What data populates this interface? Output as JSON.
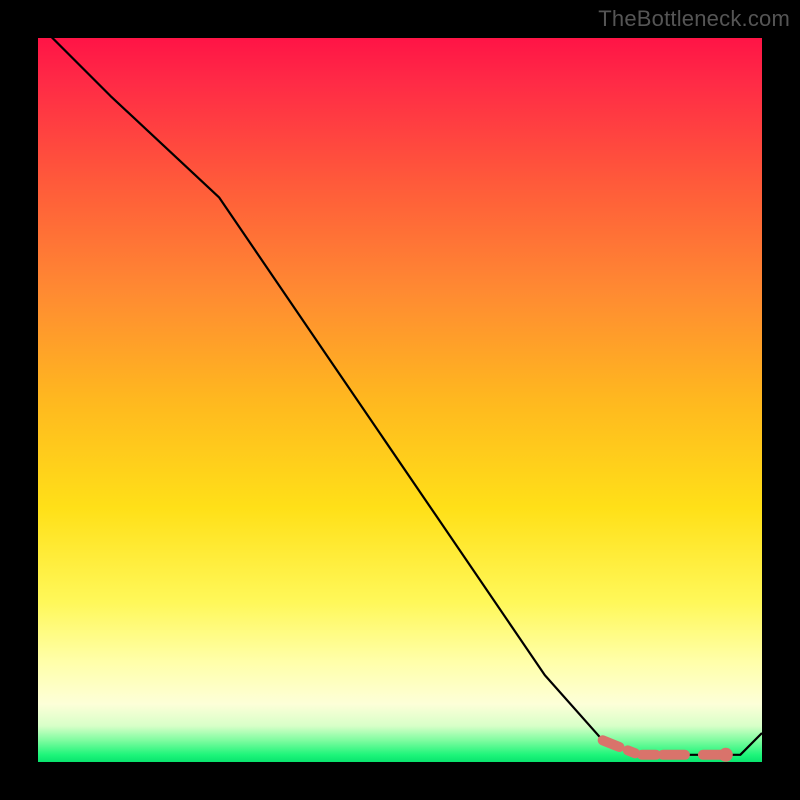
{
  "watermark": "TheBottleneck.com",
  "colors": {
    "gradient_top": "#ff1446",
    "gradient_bottom": "#08e46e",
    "line": "#000000",
    "tail_highlight": "#d9736b",
    "tail_dot": "#d9736b",
    "frame_bg": "#000000"
  },
  "chart_data": {
    "type": "line",
    "title": "",
    "xlabel": "",
    "ylabel": "",
    "xlim": [
      0,
      100
    ],
    "ylim": [
      0,
      100
    ],
    "grid": false,
    "legend": false,
    "series": [
      {
        "name": "curve",
        "x": [
          0,
          10,
          25,
          40,
          55,
          70,
          78,
          83,
          86,
          89,
          92,
          94,
          95,
          97,
          100
        ],
        "y": [
          102,
          92,
          78,
          56,
          34,
          12,
          3,
          1,
          1,
          1,
          1,
          1,
          1,
          1,
          4
        ]
      }
    ],
    "tail_highlight_range": {
      "x_start": 78,
      "x_end": 95,
      "style": "thick-dashed"
    },
    "tail_end_dot": {
      "x": 95,
      "y": 1
    }
  }
}
